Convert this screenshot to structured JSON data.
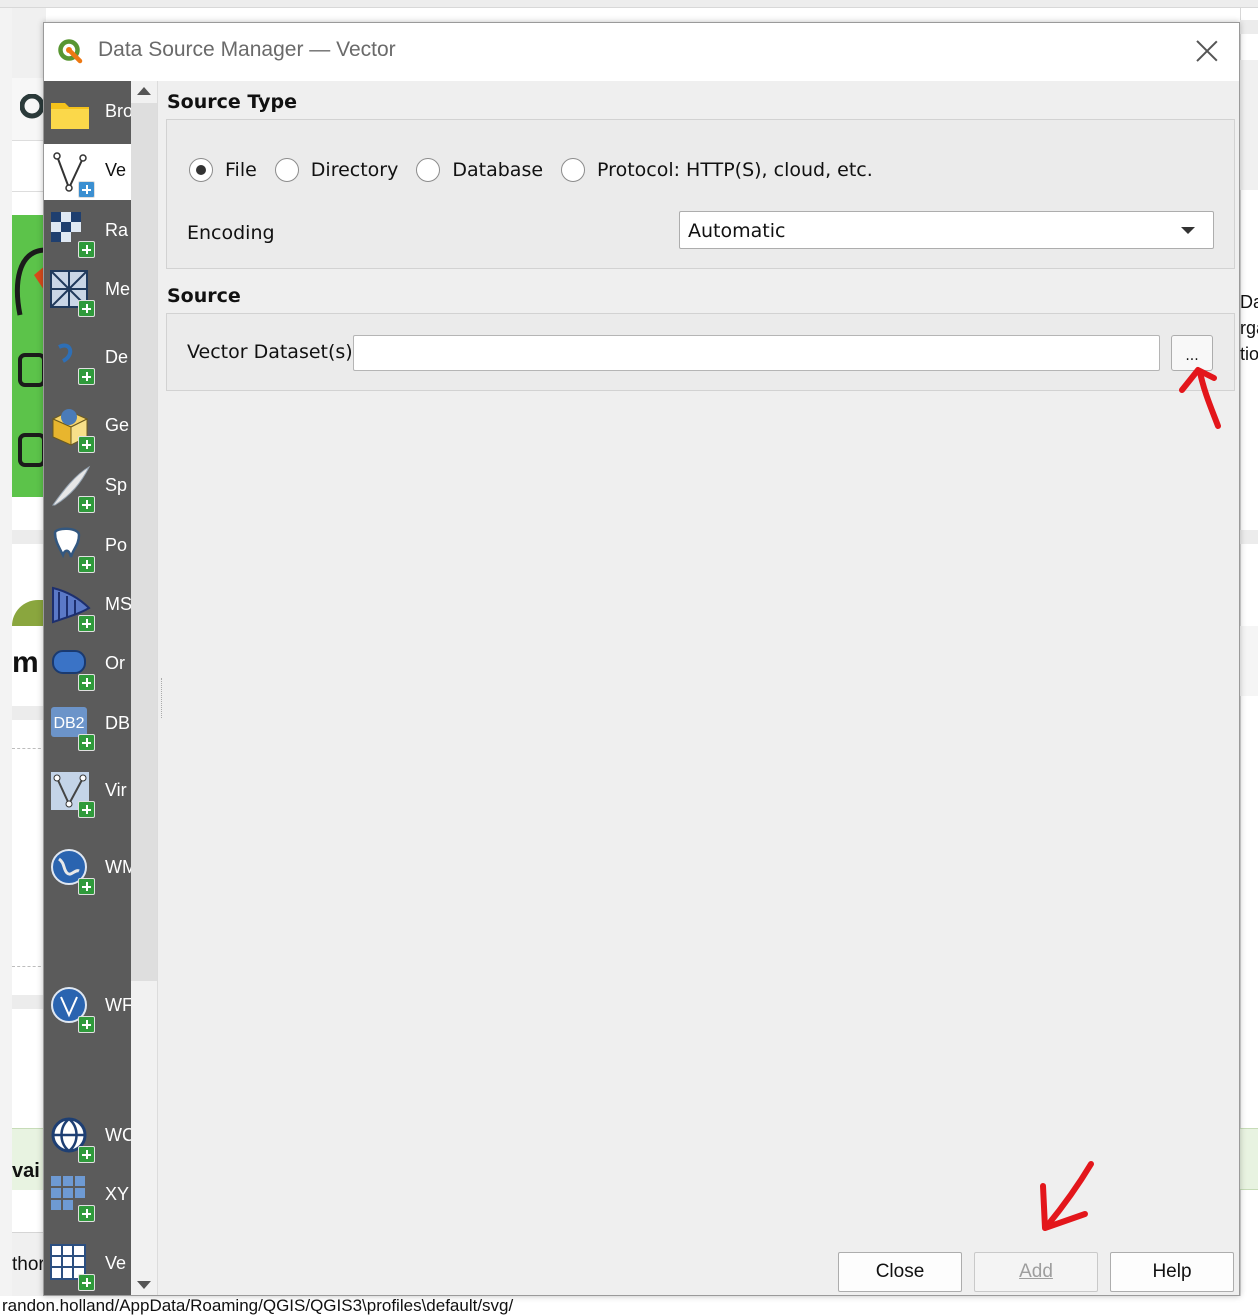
{
  "dialog": {
    "title": "Data Source Manager — Vector"
  },
  "sidebar": {
    "items": [
      {
        "label": "Bro",
        "icon": "folder-icon"
      },
      {
        "label": "Ve",
        "icon": "vector-layer-icon"
      },
      {
        "label": "Ra",
        "icon": "raster-layer-icon"
      },
      {
        "label": "Me",
        "icon": "mesh-layer-icon"
      },
      {
        "label": "De",
        "icon": "delimited-text-icon"
      },
      {
        "label": "Ge",
        "icon": "geopackage-icon"
      },
      {
        "label": "Sp",
        "icon": "spatialite-icon"
      },
      {
        "label": "Po",
        "icon": "postgis-icon"
      },
      {
        "label": "MS",
        "icon": "mssql-icon"
      },
      {
        "label": "Or",
        "icon": "oracle-icon"
      },
      {
        "label": "DB",
        "icon": "db2-icon",
        "badge": "DB2"
      },
      {
        "label": "Vir",
        "icon": "virtual-layer-icon"
      },
      {
        "label": "WM",
        "icon": "wms-icon"
      },
      {
        "label": "WF",
        "icon": "wfs-icon"
      },
      {
        "label": "WC",
        "icon": "wcs-icon"
      },
      {
        "label": "XY",
        "icon": "xyz-tiles-icon"
      },
      {
        "label": "Ve",
        "icon": "vector-tiles-icon"
      }
    ]
  },
  "source_type": {
    "heading": "Source Type",
    "options": [
      {
        "label": "File",
        "checked": true
      },
      {
        "label": "Directory",
        "checked": false
      },
      {
        "label": "Database",
        "checked": false
      },
      {
        "label": "Protocol: HTTP(S), cloud, etc.",
        "checked": false
      }
    ],
    "encoding_label": "Encoding",
    "encoding_value": "Automatic"
  },
  "source": {
    "heading": "Source",
    "dataset_label": "Vector Dataset(s)",
    "dataset_value": "",
    "browse_label": "..."
  },
  "buttons": {
    "close": "Close",
    "add": "Add",
    "help": "Help"
  },
  "background": {
    "path_text": "randon.holland/AppData/Roaming/QGIS/QGIS3\\profiles\\default/svg/",
    "left_fragments": {
      "heading_fragment": "m",
      "avail_fragment": "vai",
      "author_fragment": "thor"
    },
    "right_fragments": {
      "line1": "Dav",
      "line2": "rga",
      "line3": "tio"
    }
  },
  "colors": {
    "sidebar_bg": "#5b5b5b",
    "dialog_bg": "#efefef",
    "annotation_red": "#e3161b",
    "plus_green": "#2f9a3b"
  }
}
